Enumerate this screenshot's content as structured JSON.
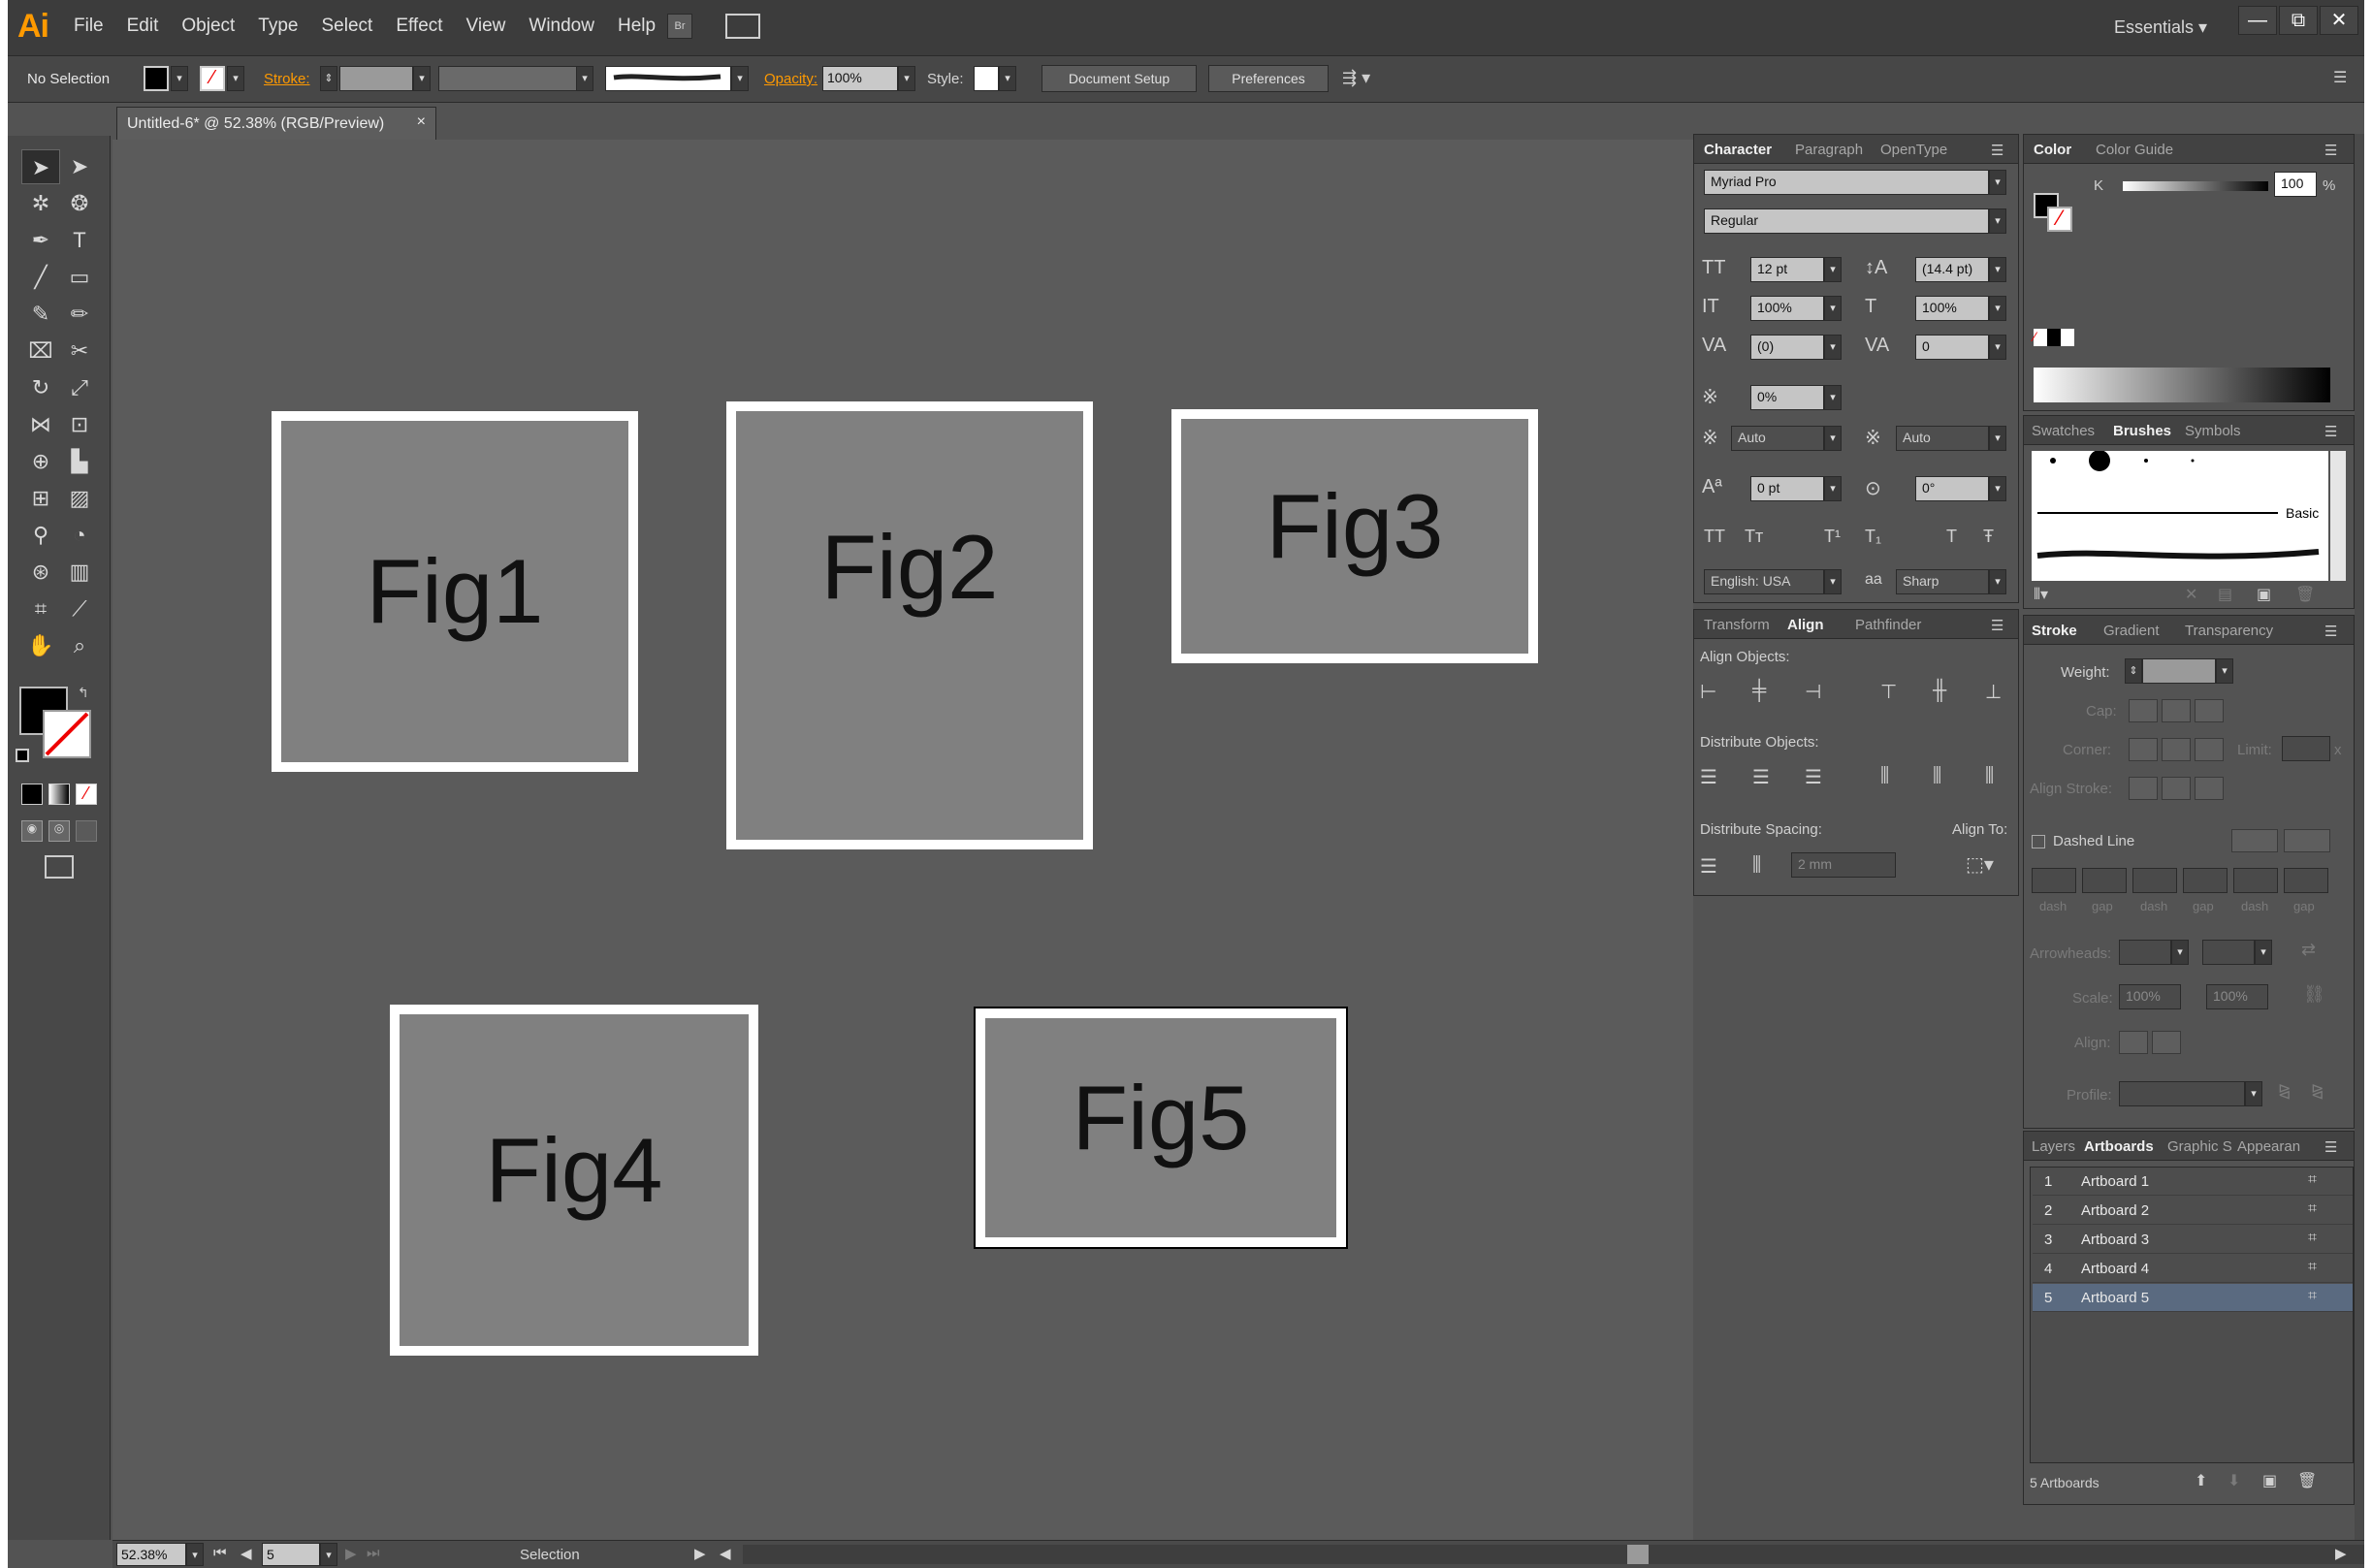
{
  "app": {
    "logo": "Ai",
    "menu": [
      "File",
      "Edit",
      "Object",
      "Type",
      "Select",
      "Effect",
      "View",
      "Window",
      "Help"
    ],
    "bridge_label": "Br",
    "workspace": "Essentials",
    "window_controls": {
      "minimize": "—",
      "restore": "⧉",
      "close": "✕"
    }
  },
  "control_bar": {
    "selection": "No Selection",
    "stroke_label": "Stroke:",
    "opacity_label": "Opacity:",
    "opacity_value": "100%",
    "style_label": "Style:",
    "document_setup": "Document Setup",
    "preferences": "Preferences"
  },
  "document": {
    "tab_title": "Untitled-6* @ 52.38% (RGB/Preview)",
    "tab_close": "×"
  },
  "artboards": [
    {
      "label": "Fig1"
    },
    {
      "label": "Fig2"
    },
    {
      "label": "Fig3"
    },
    {
      "label": "Fig4"
    },
    {
      "label": "Fig5"
    }
  ],
  "status": {
    "zoom": "52.38%",
    "artboard_nav": "5",
    "tool_label": "Selection"
  },
  "character_panel": {
    "tabs": [
      "Character",
      "Paragraph",
      "OpenType"
    ],
    "font_family": "Myriad Pro",
    "font_style": "Regular",
    "size": "12 pt",
    "leading": "(14.4 pt)",
    "vscale": "100%",
    "hscale": "100%",
    "kerning": "(0)",
    "tracking": "0",
    "tsume": "0%",
    "aki_left": "Auto",
    "aki_right": "Auto",
    "baseline": "0 pt",
    "rotation": "0°",
    "language": "English: USA",
    "aa_label": "a",
    "antialias": "Sharp"
  },
  "align_panel": {
    "tabs": [
      "Transform",
      "Align",
      "Pathfinder"
    ],
    "align_objects": "Align Objects:",
    "distribute_objects": "Distribute Objects:",
    "distribute_spacing": "Distribute Spacing:",
    "align_to": "Align To:",
    "spacing_value": "2 mm"
  },
  "color_panel": {
    "tabs": [
      "Color",
      "Color Guide"
    ],
    "channel": "K",
    "value": "100",
    "unit": "%"
  },
  "brushes_panel": {
    "tabs": [
      "Swatches",
      "Brushes",
      "Symbols"
    ],
    "basic_label": "Basic"
  },
  "stroke_panel": {
    "tabs": [
      "Stroke",
      "Gradient",
      "Transparency"
    ],
    "weight": "Weight:",
    "cap": "Cap:",
    "corner": "Corner:",
    "limit": "Limit:",
    "limit_x": "x",
    "align_stroke": "Align Stroke:",
    "dashed_line": "Dashed Line",
    "dash_labels": [
      "dash",
      "gap",
      "dash",
      "gap",
      "dash",
      "gap"
    ],
    "arrowheads": "Arrowheads:",
    "scale": "Scale:",
    "scale_values": [
      "100%",
      "100%"
    ],
    "align": "Align:",
    "profile": "Profile:"
  },
  "artboards_panel": {
    "tabs": [
      "Layers",
      "Artboards",
      "Graphic S",
      "Appearan"
    ],
    "rows": [
      {
        "num": "1",
        "name": "Artboard 1"
      },
      {
        "num": "2",
        "name": "Artboard 2"
      },
      {
        "num": "3",
        "name": "Artboard 3"
      },
      {
        "num": "4",
        "name": "Artboard 4"
      },
      {
        "num": "5",
        "name": "Artboard 5"
      }
    ],
    "footer": "5 Artboards"
  },
  "colors": {
    "interface": "#535353",
    "artboard_fill": "#808080",
    "accent": "#ff9a00",
    "selected_row": "#5a6a80"
  }
}
